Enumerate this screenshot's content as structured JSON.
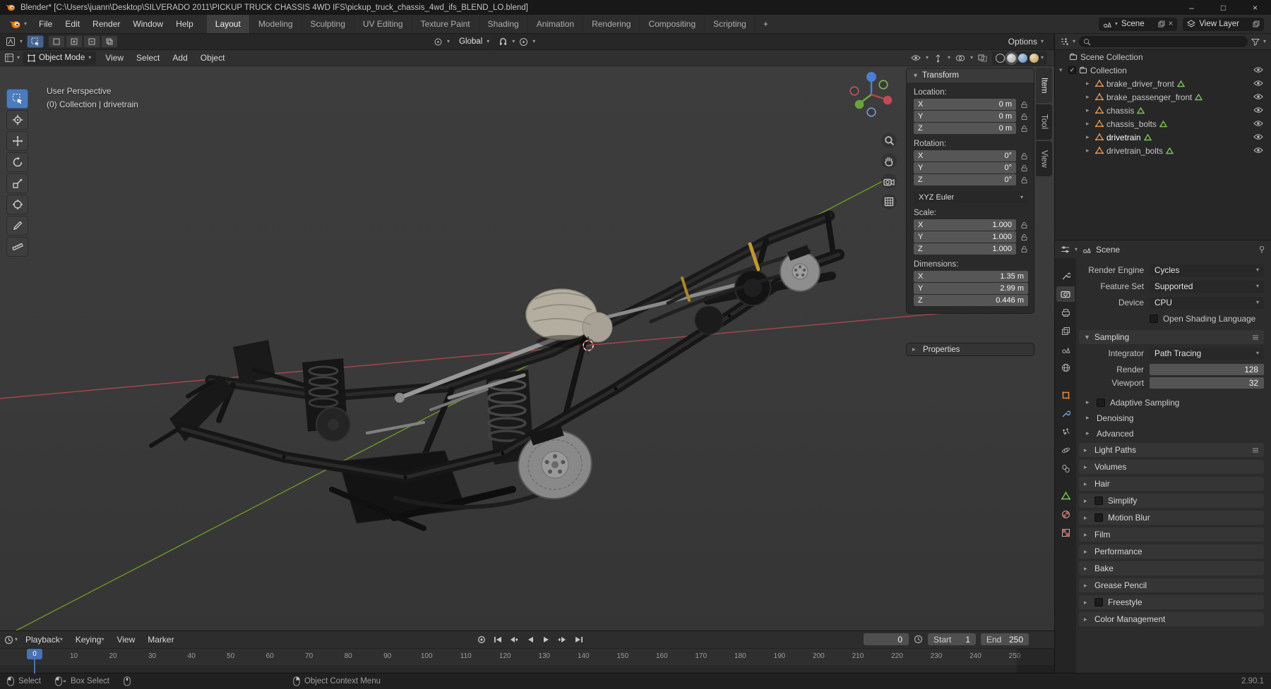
{
  "colors": {
    "accent_blue": "#4772b3",
    "mesh_orange": "#ec9b57",
    "data_green": "#79c353",
    "axis_red": "#b84a52",
    "axis_green": "#74a422"
  },
  "titlebar": {
    "app_title": "Blender* [C:\\Users\\juann\\Desktop\\SILVERADO 2011\\PICKUP TRUCK CHASSIS 4WD IFS\\pickup_truck_chassis_4wd_ifs_BLEND_LO.blend]"
  },
  "topbar": {
    "menus": [
      "File",
      "Edit",
      "Render",
      "Window",
      "Help"
    ],
    "workspaces": [
      "Layout",
      "Modeling",
      "Sculpting",
      "UV Editing",
      "Texture Paint",
      "Shading",
      "Animation",
      "Rendering",
      "Compositing",
      "Scripting"
    ],
    "active_workspace": "Layout",
    "add_workspace": "+",
    "scene_label": "Scene",
    "view_layer_label": "View Layer"
  },
  "tool_header": {
    "orientation_value": "Global",
    "options_label": "Options"
  },
  "viewport": {
    "mode_value": "Object Mode",
    "menus": [
      "View",
      "Select",
      "Add",
      "Object"
    ],
    "overlay_line1": "User Perspective",
    "overlay_line2": "(0) Collection | drivetrain",
    "side_tabs": [
      "Item",
      "Tool",
      "View"
    ],
    "active_side_tab": "Item"
  },
  "transform": {
    "title": "Transform",
    "groups": [
      {
        "label": "Location:",
        "rows": [
          [
            "X",
            "0 m"
          ],
          [
            "Y",
            "0 m"
          ],
          [
            "Z",
            "0 m"
          ]
        ],
        "locks": true
      },
      {
        "label": "Rotation:",
        "rows": [
          [
            "X",
            "0°"
          ],
          [
            "Y",
            "0°"
          ],
          [
            "Z",
            "0°"
          ]
        ],
        "locks": true
      },
      {
        "label": "Scale:",
        "rows": [
          [
            "X",
            "1.000"
          ],
          [
            "Y",
            "1.000"
          ],
          [
            "Z",
            "1.000"
          ]
        ],
        "locks": true
      },
      {
        "label": "Dimensions:",
        "rows": [
          [
            "X",
            "1.35 m"
          ],
          [
            "Y",
            "2.99 m"
          ],
          [
            "Z",
            "0.446 m"
          ]
        ],
        "locks": false
      }
    ],
    "rotation_mode": "XYZ Euler",
    "properties_label": "Properties"
  },
  "outliner": {
    "scene_collection": "Scene Collection",
    "collection": "Collection",
    "items": [
      {
        "name": "brake_driver_front",
        "active": false
      },
      {
        "name": "brake_passenger_front",
        "active": false
      },
      {
        "name": "chassis",
        "active": false
      },
      {
        "name": "chassis_bolts",
        "active": false
      },
      {
        "name": "drivetrain",
        "active": true
      },
      {
        "name": "drivetrain_bolts",
        "active": false
      }
    ]
  },
  "properties": {
    "breadcrumb": "Scene",
    "rows": [
      {
        "label": "Render Engine",
        "value": "Cycles"
      },
      {
        "label": "Feature Set",
        "value": "Supported"
      },
      {
        "label": "Device",
        "value": "CPU"
      },
      {
        "label": "Open Shading Language"
      }
    ],
    "sampling": {
      "title": "Sampling",
      "integrator_label": "Integrator",
      "integrator_value": "Path Tracing",
      "render_label": "Render",
      "render_value": "128",
      "viewport_label": "Viewport",
      "viewport_value": "32",
      "subsections": [
        {
          "title": "Adaptive Sampling",
          "checkbox": true
        },
        {
          "title": "Denoising",
          "checkbox": false
        },
        {
          "title": "Advanced",
          "checkbox": false
        }
      ]
    },
    "sections": [
      {
        "title": "Light Paths",
        "checkbox": false,
        "menu": true
      },
      {
        "title": "Volumes",
        "checkbox": false
      },
      {
        "title": "Hair",
        "checkbox": false
      },
      {
        "title": "Simplify",
        "checkbox": true
      },
      {
        "title": "Motion Blur",
        "checkbox": true
      },
      {
        "title": "Film",
        "checkbox": false
      },
      {
        "title": "Performance",
        "checkbox": false
      },
      {
        "title": "Bake",
        "checkbox": false
      },
      {
        "title": "Grease Pencil",
        "checkbox": false
      },
      {
        "title": "Freestyle",
        "checkbox": true
      },
      {
        "title": "Color Management",
        "checkbox": false
      }
    ]
  },
  "timeline": {
    "menus": [
      "Playback",
      "Keying",
      "View",
      "Marker"
    ],
    "current_frame": "0",
    "start_label": "Start",
    "start_value": "1",
    "end_label": "End",
    "end_value": "250",
    "tick_start": 0,
    "tick_end": 250,
    "tick_step": 10,
    "playhead_label": "0"
  },
  "statusbar": {
    "items": [
      "Select",
      "Box Select",
      "Object Context Menu"
    ],
    "version": "2.90.1"
  }
}
